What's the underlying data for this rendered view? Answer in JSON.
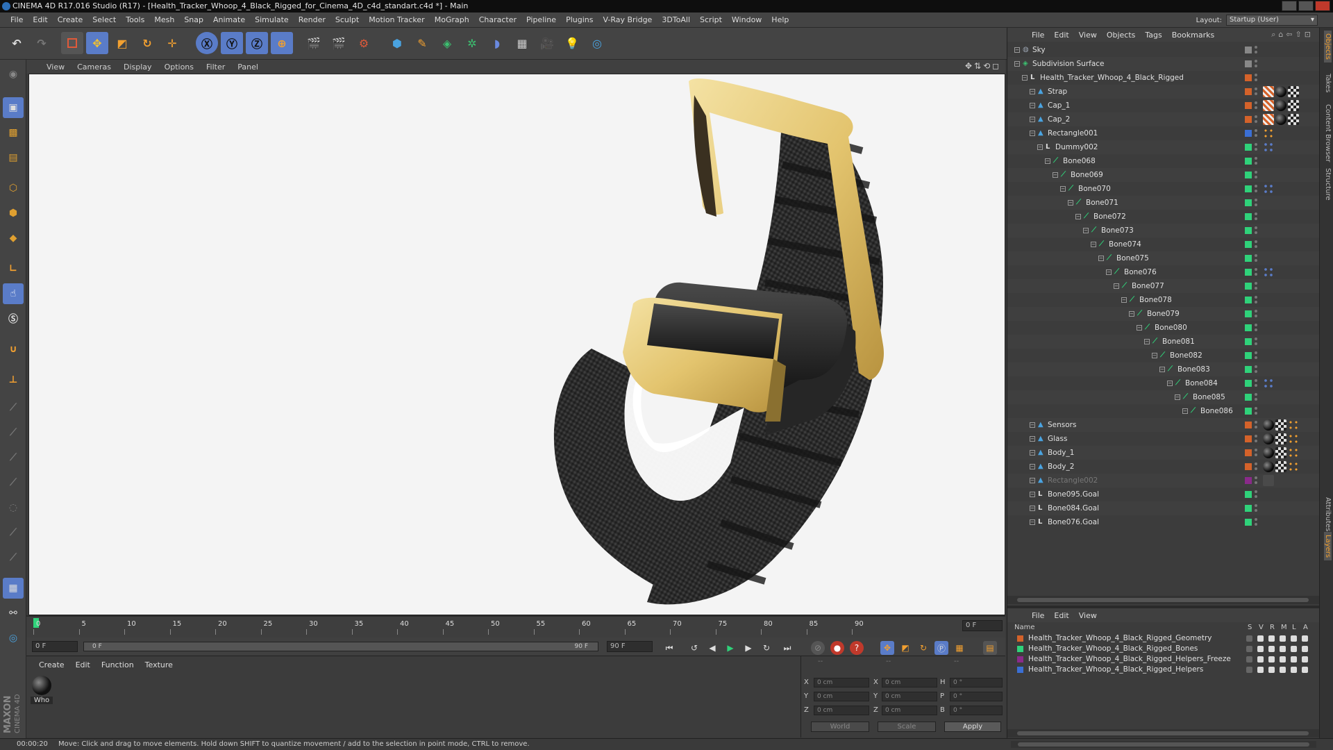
{
  "window": {
    "title": "CINEMA 4D R17.016 Studio (R17) - [Health_Tracker_Whoop_4_Black_Rigged_for_Cinema_4D_c4d_standart.c4d *] - Main"
  },
  "menubar": {
    "items": [
      "File",
      "Edit",
      "Create",
      "Select",
      "Tools",
      "Mesh",
      "Snap",
      "Animate",
      "Simulate",
      "Render",
      "Sculpt",
      "Motion Tracker",
      "MoGraph",
      "Character",
      "Pipeline",
      "Plugins",
      "V-Ray Bridge",
      "3DToAll",
      "Script",
      "Window",
      "Help"
    ]
  },
  "layout": {
    "label": "Layout:",
    "value": "Startup (User)"
  },
  "viewport": {
    "menu": [
      "View",
      "Cameras",
      "Display",
      "Options",
      "Filter",
      "Panel"
    ]
  },
  "timeline": {
    "ticks": [
      "0",
      "5",
      "10",
      "15",
      "20",
      "25",
      "30",
      "35",
      "40",
      "45",
      "50",
      "55",
      "60",
      "65",
      "70",
      "75",
      "80",
      "85",
      "90"
    ],
    "frame_field": "0 F"
  },
  "transport": {
    "start": "0 F",
    "range_start": "0 F",
    "range_end": "90 F",
    "end": "90 F"
  },
  "materials": {
    "menu": [
      "Create",
      "Edit",
      "Function",
      "Texture"
    ],
    "items": [
      {
        "name": "Who"
      }
    ]
  },
  "coords": {
    "header": [
      "--",
      "--",
      "--"
    ],
    "rows": [
      {
        "a": "X",
        "av": "0 cm",
        "b": "X",
        "bv": "0 cm",
        "c": "H",
        "cv": "0 °"
      },
      {
        "a": "Y",
        "av": "0 cm",
        "b": "Y",
        "bv": "0 cm",
        "c": "P",
        "cv": "0 °"
      },
      {
        "a": "Z",
        "av": "0 cm",
        "b": "Z",
        "bv": "0 cm",
        "c": "B",
        "cv": "0 °"
      }
    ],
    "world": "World",
    "scale": "Scale",
    "apply": "Apply"
  },
  "objects": {
    "menu": [
      "File",
      "Edit",
      "View",
      "Objects",
      "Tags",
      "Bookmarks"
    ],
    "rows": [
      {
        "name": "Sky",
        "depth": 0,
        "icon": "sky",
        "color": "#888888",
        "tags": []
      },
      {
        "name": "Subdivision Surface",
        "depth": 0,
        "icon": "subdiv",
        "color": "#888888",
        "tags": []
      },
      {
        "name": "Health_Tracker_Whoop_4_Black_Rigged",
        "depth": 1,
        "icon": "null",
        "color": "#d4622a",
        "tags": []
      },
      {
        "name": "Strap",
        "depth": 2,
        "icon": "poly",
        "color": "#d4622a",
        "tags": [
          "pattern",
          "sphere",
          "checker"
        ]
      },
      {
        "name": "Cap_1",
        "depth": 2,
        "icon": "poly",
        "color": "#d4622a",
        "tags": [
          "pattern",
          "sphere",
          "checker"
        ]
      },
      {
        "name": "Cap_2",
        "depth": 2,
        "icon": "poly",
        "color": "#d4622a",
        "tags": [
          "pattern",
          "sphere",
          "checker"
        ]
      },
      {
        "name": "Rectangle001",
        "depth": 2,
        "icon": "poly",
        "color": "#3b6fd4",
        "tags": [
          "dots"
        ]
      },
      {
        "name": "Dummy002",
        "depth": 3,
        "icon": "null",
        "color": "#2fd27a",
        "tags": [
          "ik"
        ]
      },
      {
        "name": "Bone068",
        "depth": 4,
        "icon": "bone",
        "color": "#2fd27a",
        "tags": []
      },
      {
        "name": "Bone069",
        "depth": 5,
        "icon": "bone",
        "color": "#2fd27a",
        "tags": []
      },
      {
        "name": "Bone070",
        "depth": 6,
        "icon": "bone",
        "color": "#2fd27a",
        "tags": [
          "ik"
        ]
      },
      {
        "name": "Bone071",
        "depth": 7,
        "icon": "bone",
        "color": "#2fd27a",
        "tags": []
      },
      {
        "name": "Bone072",
        "depth": 8,
        "icon": "bone",
        "color": "#2fd27a",
        "tags": []
      },
      {
        "name": "Bone073",
        "depth": 9,
        "icon": "bone",
        "color": "#2fd27a",
        "tags": []
      },
      {
        "name": "Bone074",
        "depth": 10,
        "icon": "bone",
        "color": "#2fd27a",
        "tags": []
      },
      {
        "name": "Bone075",
        "depth": 11,
        "icon": "bone",
        "color": "#2fd27a",
        "tags": []
      },
      {
        "name": "Bone076",
        "depth": 12,
        "icon": "bone",
        "color": "#2fd27a",
        "tags": [
          "ik"
        ]
      },
      {
        "name": "Bone077",
        "depth": 13,
        "icon": "bone",
        "color": "#2fd27a",
        "tags": []
      },
      {
        "name": "Bone078",
        "depth": 14,
        "icon": "bone",
        "color": "#2fd27a",
        "tags": []
      },
      {
        "name": "Bone079",
        "depth": 15,
        "icon": "bone",
        "color": "#2fd27a",
        "tags": []
      },
      {
        "name": "Bone080",
        "depth": 16,
        "icon": "bone",
        "color": "#2fd27a",
        "tags": []
      },
      {
        "name": "Bone081",
        "depth": 17,
        "icon": "bone",
        "color": "#2fd27a",
        "tags": []
      },
      {
        "name": "Bone082",
        "depth": 18,
        "icon": "bone",
        "color": "#2fd27a",
        "tags": []
      },
      {
        "name": "Bone083",
        "depth": 19,
        "icon": "bone",
        "color": "#2fd27a",
        "tags": []
      },
      {
        "name": "Bone084",
        "depth": 20,
        "icon": "bone",
        "color": "#2fd27a",
        "tags": [
          "ik"
        ]
      },
      {
        "name": "Bone085",
        "depth": 21,
        "icon": "bone",
        "color": "#2fd27a",
        "tags": []
      },
      {
        "name": "Bone086",
        "depth": 22,
        "icon": "bone",
        "color": "#2fd27a",
        "tags": []
      },
      {
        "name": "Sensors",
        "depth": 2,
        "icon": "poly",
        "color": "#d4622a",
        "tags": [
          "sphere",
          "checker",
          "dots"
        ]
      },
      {
        "name": "Glass",
        "depth": 2,
        "icon": "poly",
        "color": "#d4622a",
        "tags": [
          "sphere",
          "checker",
          "dots"
        ]
      },
      {
        "name": "Body_1",
        "depth": 2,
        "icon": "poly",
        "color": "#d4622a",
        "tags": [
          "sphere",
          "checker",
          "dots"
        ]
      },
      {
        "name": "Body_2",
        "depth": 2,
        "icon": "poly",
        "color": "#d4622a",
        "tags": [
          "sphere",
          "checker",
          "dots"
        ]
      },
      {
        "name": "Rectangle002",
        "depth": 2,
        "icon": "poly",
        "color": "#8a2a8a",
        "tags": [
          "dim"
        ],
        "dim": true
      },
      {
        "name": "Bone095.Goal",
        "depth": 2,
        "icon": "null",
        "color": "#2fd27a",
        "tags": []
      },
      {
        "name": "Bone084.Goal",
        "depth": 2,
        "icon": "null",
        "color": "#2fd27a",
        "tags": []
      },
      {
        "name": "Bone076.Goal",
        "depth": 2,
        "icon": "null",
        "color": "#2fd27a",
        "tags": []
      }
    ]
  },
  "layers": {
    "menu": [
      "File",
      "Edit",
      "View"
    ],
    "header": {
      "name": "Name",
      "cols": [
        "S",
        "V",
        "R",
        "M",
        "L",
        "A"
      ]
    },
    "rows": [
      {
        "name": "Health_Tracker_Whoop_4_Black_Rigged_Geometry",
        "color": "#d4622a"
      },
      {
        "name": "Health_Tracker_Whoop_4_Black_Rigged_Bones",
        "color": "#2fd27a"
      },
      {
        "name": "Health_Tracker_Whoop_4_Black_Rigged_Helpers_Freeze",
        "color": "#8a2a8a"
      },
      {
        "name": "Health_Tracker_Whoop_4_Black_Rigged_Helpers",
        "color": "#3b6fd4"
      }
    ]
  },
  "sidetabs": [
    "Objects",
    "Takes",
    "Content Browser",
    "Structure"
  ],
  "sidetabs_lower": [
    "Attributes",
    "Layers"
  ],
  "status": {
    "time": "00:00:20",
    "message": "Move: Click and drag to move elements. Hold down SHIFT to quantize movement / add to the selection in point mode, CTRL to remove."
  },
  "branding": {
    "line1": "MAXON",
    "line2": "CINEMA 4D"
  }
}
